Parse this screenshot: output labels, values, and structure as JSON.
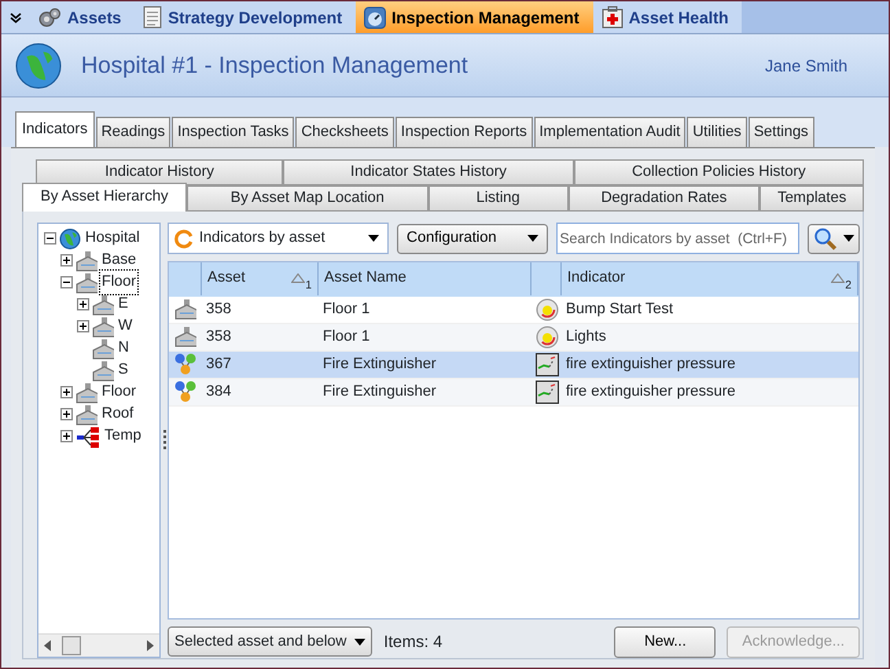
{
  "module_tabs": [
    {
      "label": "Assets",
      "kind": "gears",
      "selected": false
    },
    {
      "label": "Strategy Development",
      "kind": "document",
      "selected": false
    },
    {
      "label": "Inspection Management",
      "kind": "gauge",
      "selected": true
    },
    {
      "label": "Asset Health",
      "kind": "medkit",
      "selected": false
    }
  ],
  "header": {
    "title": "Hospital #1 - Inspection Management",
    "user": "Jane Smith"
  },
  "main_tabs": [
    {
      "label": "Indicators",
      "selected": true
    },
    {
      "label": "Readings",
      "selected": false
    },
    {
      "label": "Inspection Tasks",
      "selected": false
    },
    {
      "label": "Checksheets",
      "selected": false
    },
    {
      "label": "Inspection Reports",
      "selected": false
    },
    {
      "label": "Implementation Audit",
      "selected": false
    },
    {
      "label": "Utilities",
      "selected": false
    },
    {
      "label": "Settings",
      "selected": false
    }
  ],
  "sub_tabs_back": [
    {
      "label": "Indicator History",
      "selected": false
    },
    {
      "label": "Indicator States History",
      "selected": false
    },
    {
      "label": "Collection Policies History",
      "selected": false
    }
  ],
  "sub_tabs_front": [
    {
      "label": "By Asset Hierarchy",
      "selected": true
    },
    {
      "label": "By Asset Map Location",
      "selected": false
    },
    {
      "label": "Listing",
      "selected": false
    },
    {
      "label": "Degradation Rates",
      "selected": false
    },
    {
      "label": "Templates",
      "selected": false
    }
  ],
  "tree": [
    {
      "label": "Hospital",
      "kind": "globe",
      "expanded": true,
      "selected": false,
      "children": [
        {
          "label": "Base",
          "kind": "building",
          "expanded": false,
          "selected": false
        },
        {
          "label": "Floor",
          "kind": "building",
          "expanded": true,
          "selected": true,
          "children": [
            {
              "label": "E",
              "kind": "building",
              "expanded": false,
              "selected": false
            },
            {
              "label": "W",
              "kind": "building",
              "expanded": false,
              "selected": false
            },
            {
              "label": "N",
              "kind": "building",
              "selected": false
            },
            {
              "label": "S",
              "kind": "building",
              "selected": false
            }
          ]
        },
        {
          "label": "Floor",
          "kind": "building",
          "expanded": false,
          "selected": false
        },
        {
          "label": "Roof",
          "kind": "building",
          "expanded": false,
          "selected": false
        },
        {
          "label": "Temp",
          "kind": "template",
          "expanded": false,
          "selected": false
        }
      ]
    }
  ],
  "toolbar": {
    "view": "Indicators by asset",
    "configuration": "Configuration",
    "search": {
      "placeholder": "Search Indicators by asset  (Ctrl+F)"
    }
  },
  "grid": {
    "columns": [
      {
        "label": "Asset",
        "sort": "1"
      },
      {
        "label": "Asset Name"
      },
      {
        "label": "Indicator",
        "sort": "2"
      }
    ],
    "rows": [
      {
        "kind": "building",
        "asset": "358",
        "asset_name": "Floor 1",
        "indicator": {
          "kind": "gauge",
          "label": "Bump Start Test"
        },
        "selected": false
      },
      {
        "kind": "building",
        "asset": "358",
        "asset_name": "Floor 1",
        "indicator": {
          "kind": "gauge",
          "label": "Lights"
        },
        "selected": false
      },
      {
        "kind": "component",
        "asset": "367",
        "asset_name": "Fire Extinguisher",
        "indicator": {
          "kind": "trend",
          "label": "fire extinguisher pressure"
        },
        "selected": true
      },
      {
        "kind": "component",
        "asset": "384",
        "asset_name": "Fire Extinguisher",
        "indicator": {
          "kind": "trend",
          "label": "fire extinguisher pressure"
        },
        "selected": false
      }
    ]
  },
  "footer": {
    "scope": "Selected asset and below",
    "count": "Items: 4",
    "buttons": [
      {
        "label": "New...",
        "disabled": false
      },
      {
        "label": "Acknowledge...",
        "disabled": true
      }
    ]
  }
}
